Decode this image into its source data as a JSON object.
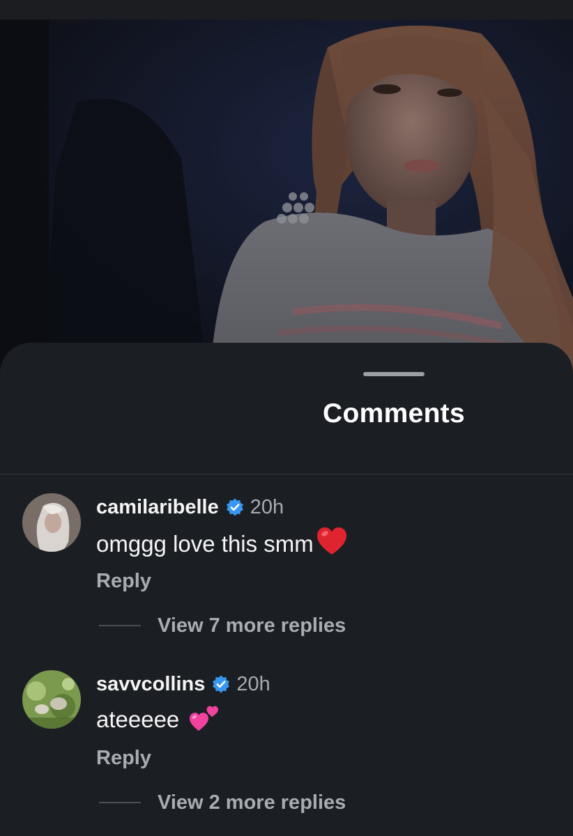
{
  "sheet": {
    "title": "Comments"
  },
  "comments": [
    {
      "username": "camilaribelle",
      "verified": true,
      "time": "20h",
      "text": "omggg love this smm",
      "emoji": "red-heart",
      "reply_label": "Reply",
      "view_replies": "View 7 more replies"
    },
    {
      "username": "savvcollins",
      "verified": true,
      "time": "20h",
      "text": "ateeeee",
      "emoji": "two-hearts",
      "reply_label": "Reply",
      "view_replies": "View 2 more replies"
    }
  ],
  "colors": {
    "background": "#1b1f23",
    "text": "#f5f5f5",
    "secondary_text": "#a8adb3",
    "verified_badge": "#3897f0"
  }
}
